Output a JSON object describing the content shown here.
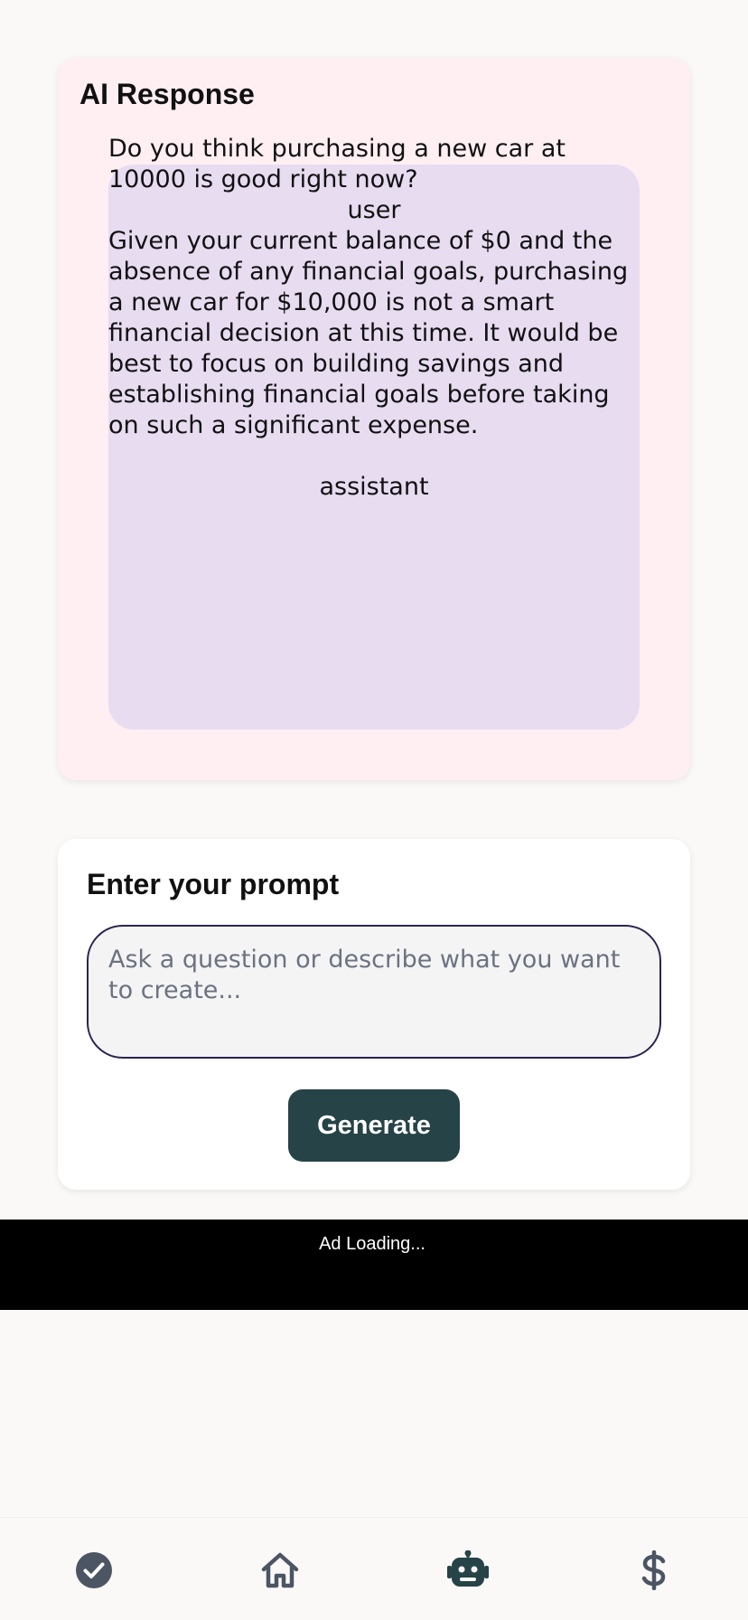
{
  "response": {
    "title": "AI Response",
    "messages": [
      {
        "text": "Do you think purchasing a new car at 10000 is good right now?",
        "role": "user"
      },
      {
        "text": "Given your current balance of $0 and the absence of any financial goals, purchasing a new car for $10,000 is not a smart financial decision at this time. It would be best to focus on building savings and establishing financial goals before taking on such a significant expense.",
        "role": "assistant"
      }
    ]
  },
  "prompt": {
    "title": "Enter your prompt",
    "placeholder": "Ask a question or describe what you want to create...",
    "value": "",
    "generate_label": "Generate"
  },
  "ad": {
    "text": "Ad Loading..."
  },
  "nav": {
    "items": [
      {
        "icon": "check-circle-icon",
        "active": false
      },
      {
        "icon": "home-icon",
        "active": false
      },
      {
        "icon": "robot-icon",
        "active": true
      },
      {
        "icon": "dollar-icon",
        "active": false
      }
    ]
  },
  "colors": {
    "background": "#faf9f7",
    "response_card": "#ffeff3",
    "chat_box": "#e8dcf1",
    "accent": "#264347",
    "input_border": "#2a2350",
    "nav_icon": "#4b5563",
    "nav_icon_active": "#264347"
  }
}
